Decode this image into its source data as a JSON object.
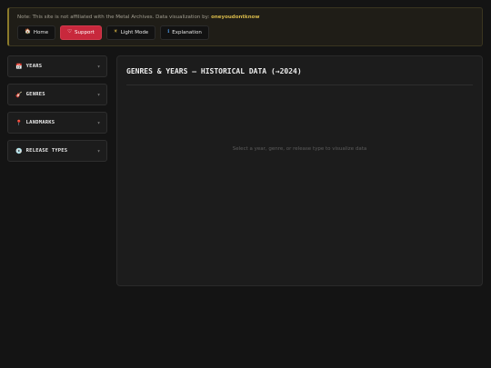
{
  "notice": {
    "text": "Note: This site is not affiliated with the Metal Archives. Data visualization by: ",
    "author": "oneyoudontknow"
  },
  "buttons": [
    {
      "label": "Home",
      "icon": "home-icon",
      "glyph": "🏠"
    },
    {
      "label": "Support",
      "icon": "heart-icon",
      "glyph": "♡"
    },
    {
      "label": "Light Mode",
      "icon": "sun-icon",
      "glyph": "☀"
    },
    {
      "label": "Explanation",
      "icon": "info-icon",
      "glyph": "ℹ"
    }
  ],
  "sidebar": {
    "items": [
      {
        "label": "YEARS",
        "icon": "calendar-icon",
        "glyph": "📅"
      },
      {
        "label": "GENRES",
        "icon": "guitar-icon",
        "glyph": "🎸"
      },
      {
        "label": "LANDMARKS",
        "icon": "pin-icon",
        "glyph": "📍"
      },
      {
        "label": "RELEASE TYPES",
        "icon": "disc-icon",
        "glyph": "💿"
      }
    ],
    "caret": "▼"
  },
  "panel": {
    "title": "GENRES & YEARS — HISTORICAL DATA (→2024)",
    "empty_message": "Select a year, genre, or release type to visualize data"
  },
  "colors": {
    "background": "#141414",
    "accent_support": "#c8283c",
    "notice_author": "#d6b84a"
  }
}
